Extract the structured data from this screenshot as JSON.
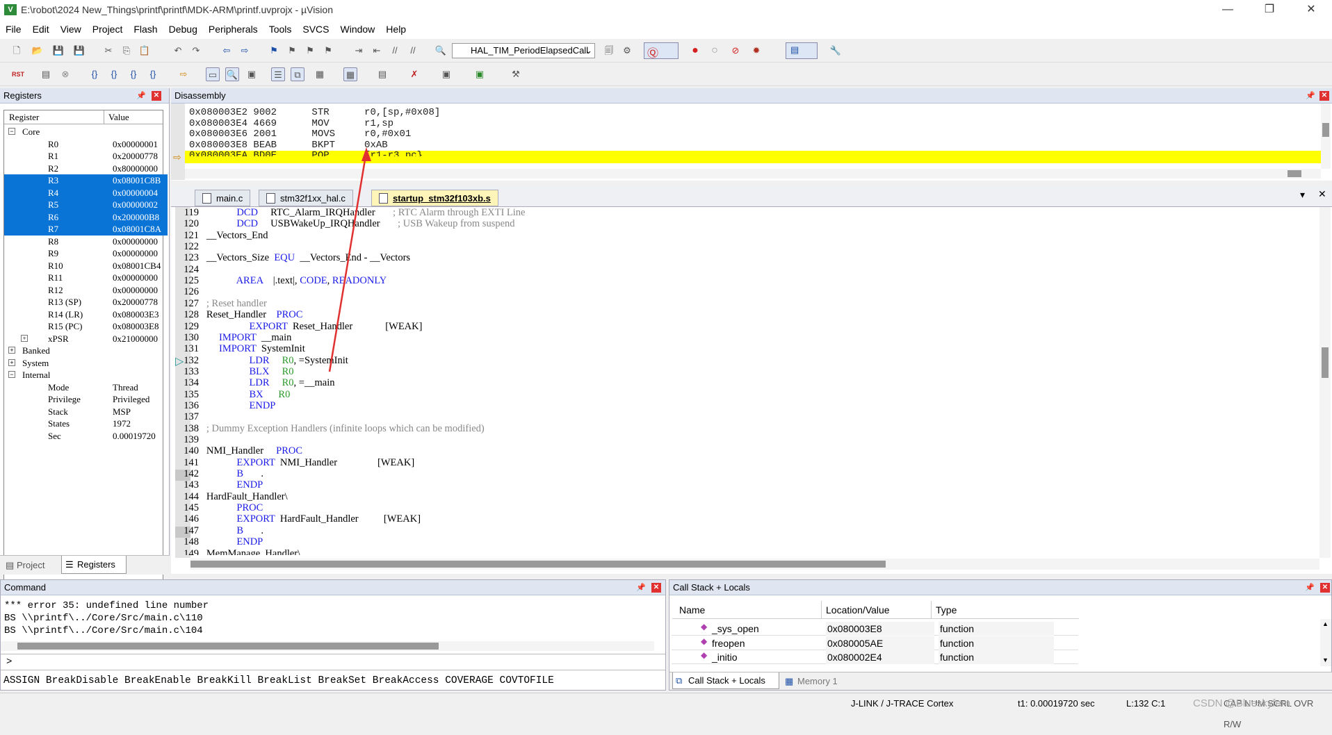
{
  "window": {
    "title": "E:\\robot\\2024 New_Things\\printf\\printf\\MDK-ARM\\printf.uvprojx - µVision",
    "icon": "V"
  },
  "menu": [
    "File",
    "Edit",
    "View",
    "Project",
    "Flash",
    "Debug",
    "Peripherals",
    "Tools",
    "SVCS",
    "Window",
    "Help"
  ],
  "toolbar": {
    "function_combo": "HAL_TIM_PeriodElapsedCall"
  },
  "registers": {
    "title": "Registers",
    "col_register": "Register",
    "col_value": "Value",
    "groups": {
      "core": "Core",
      "banked": "Banked",
      "system": "System",
      "internal": "Internal"
    },
    "core": [
      {
        "name": "R0",
        "value": "0x00000001",
        "selected": false
      },
      {
        "name": "R1",
        "value": "0x20000778",
        "selected": false
      },
      {
        "name": "R2",
        "value": "0x80000000",
        "selected": false
      },
      {
        "name": "R3",
        "value": "0x08001C8B",
        "selected": true
      },
      {
        "name": "R4",
        "value": "0x00000004",
        "selected": true
      },
      {
        "name": "R5",
        "value": "0x00000002",
        "selected": true
      },
      {
        "name": "R6",
        "value": "0x200000B8",
        "selected": true
      },
      {
        "name": "R7",
        "value": "0x08001C8A",
        "selected": true
      },
      {
        "name": "R8",
        "value": "0x00000000",
        "selected": false
      },
      {
        "name": "R9",
        "value": "0x00000000",
        "selected": false
      },
      {
        "name": "R10",
        "value": "0x08001CB4",
        "selected": false
      },
      {
        "name": "R11",
        "value": "0x00000000",
        "selected": false
      },
      {
        "name": "R12",
        "value": "0x00000000",
        "selected": false
      },
      {
        "name": "R13 (SP)",
        "value": "0x20000778",
        "selected": false
      },
      {
        "name": "R14 (LR)",
        "value": "0x080003E3",
        "selected": false
      },
      {
        "name": "R15 (PC)",
        "value": "0x080003E8",
        "selected": false
      },
      {
        "name": "xPSR",
        "value": "0x21000000",
        "selected": false
      }
    ],
    "internal": [
      {
        "name": "Mode",
        "value": "Thread"
      },
      {
        "name": "Privilege",
        "value": "Privileged"
      },
      {
        "name": "Stack",
        "value": "MSP"
      },
      {
        "name": "States",
        "value": "1972"
      },
      {
        "name": "Sec",
        "value": "0.00019720"
      }
    ],
    "tab_project": "Project",
    "tab_registers": "Registers"
  },
  "disassembly": {
    "title": "Disassembly",
    "lines": [
      "0x080003E2 9002      STR      r0,[sp,#0x08]",
      "0x080003E4 4669      MOV      r1,sp",
      "0x080003E6 2001      MOVS     r0,#0x01",
      "0x080003E8 BEAB      BKPT     0xAB",
      "0x080003EA BD0E      POP      {r1-r3,pc}"
    ]
  },
  "tabs": [
    "main.c",
    "stm32f1xx_hal.c",
    "startup_stm32f103xb.s"
  ],
  "code": [
    {
      "n": "119",
      "t": "            <k>DCD</k>     RTC_Alarm_IRQHandler       <c>; RTC Alarm through EXTI Line</c>"
    },
    {
      "n": "120",
      "t": "            <k>DCD</k>     USBWakeUp_IRQHandler       <c>; USB Wakeup from suspend</c>"
    },
    {
      "n": "121",
      "t": "__Vectors_End"
    },
    {
      "n": "122",
      "t": ""
    },
    {
      "n": "123",
      "t": "__Vectors_Size  <k>EQU</k>  __Vectors_End - __Vectors"
    },
    {
      "n": "124",
      "t": ""
    },
    {
      "n": "125",
      "t": "            <k>AREA</k>    |.text|, <k>CODE</k>, <k>READONLY</k>"
    },
    {
      "n": "126",
      "t": ""
    },
    {
      "n": "127",
      "t": "<c>; Reset handler</c>"
    },
    {
      "n": "128",
      "t": "Reset_Handler    <k>PROC</k>"
    },
    {
      "n": "129",
      "t": "                 <k>EXPORT</k>  Reset_Handler             [WEAK]"
    },
    {
      "n": "130",
      "t": "     <k>IMPORT</k>  __main"
    },
    {
      "n": "131",
      "t": "     <k>IMPORT</k>  SystemInit"
    },
    {
      "n": "132",
      "t": "                 <k>LDR</k>     <g>R0</g>, =SystemInit"
    },
    {
      "n": "133",
      "t": "                 <k>BLX</k>     <g>R0</g>"
    },
    {
      "n": "134",
      "t": "                 <k>LDR</k>     <g>R0</g>, =__main"
    },
    {
      "n": "135",
      "t": "                 <k>BX</k>      <g>R0</g>"
    },
    {
      "n": "136",
      "t": "                 <k>ENDP</k>"
    },
    {
      "n": "137",
      "t": ""
    },
    {
      "n": "138",
      "t": "<c>; Dummy Exception Handlers (infinite loops which can be modified)</c>"
    },
    {
      "n": "139",
      "t": ""
    },
    {
      "n": "140",
      "t": "NMI_Handler     <k>PROC</k>"
    },
    {
      "n": "141",
      "t": "            <k>EXPORT</k>  NMI_Handler                [WEAK]"
    },
    {
      "n": "142",
      "t": "            <k>B</k>       ."
    },
    {
      "n": "143",
      "t": "            <k>ENDP</k>"
    },
    {
      "n": "144",
      "t": "HardFault_Handler\\"
    },
    {
      "n": "145",
      "t": "            <k>PROC</k>"
    },
    {
      "n": "146",
      "t": "            <k>EXPORT</k>  HardFault_Handler          [WEAK]"
    },
    {
      "n": "147",
      "t": "            <k>B</k>       ."
    },
    {
      "n": "148",
      "t": "            <k>ENDP</k>"
    },
    {
      "n": "149",
      "t": "MemManage_Handler\\"
    }
  ],
  "command": {
    "title": "Command",
    "lines": [
      "*** error 35: undefined line number",
      "BS \\\\printf\\../Core/Src/main.c\\110",
      "BS \\\\printf\\../Core/Src/main.c\\104"
    ],
    "prompt": ">",
    "hint": "ASSIGN BreakDisable BreakEnable BreakKill BreakList BreakSet BreakAccess COVERAGE COVTOFILE"
  },
  "callstack": {
    "title": "Call Stack + Locals",
    "col_name": "Name",
    "col_loc": "Location/Value",
    "col_type": "Type",
    "rows": [
      {
        "name": "_sys_open",
        "loc": "0x080003E8",
        "type": "function"
      },
      {
        "name": "freopen",
        "loc": "0x080005AE",
        "type": "function"
      },
      {
        "name": "_initio",
        "loc": "0x080002E4",
        "type": "function"
      }
    ],
    "tab_callstack": "Call Stack + Locals",
    "tab_memory": "Memory 1"
  },
  "status": {
    "debugger": "J-LINK / J-TRACE Cortex",
    "time": "t1: 0.00019720 sec",
    "pos": "L:132 C:1",
    "flags": "CAP NUM SCRL OVR R/W",
    "watermark": "CSDN @Blueskyfern"
  }
}
